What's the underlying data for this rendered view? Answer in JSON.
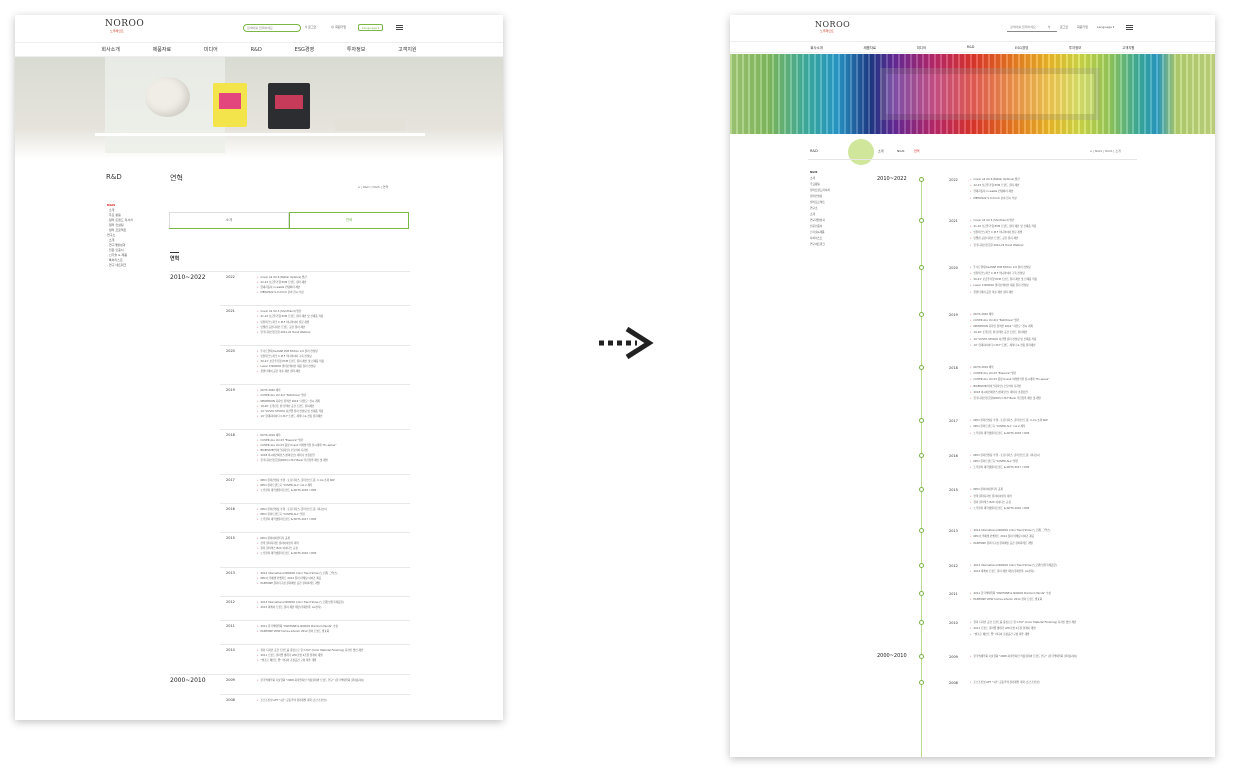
{
  "brand": {
    "logo": "NOROO",
    "logo_sub": "노루페인트"
  },
  "header": {
    "search_placeholder": "검색어를 입력하세요.",
    "login": "로그인",
    "signup": "회원가입",
    "language": "Language ▾"
  },
  "nav": [
    "회사소개",
    "제품자료",
    "미디어",
    "R&D",
    "ESG경영",
    "투자정보",
    "고객지원"
  ],
  "left": {
    "side_title": "R&D",
    "page_title": "연혁",
    "breadcrumb": "⌂ | R&D | NGIS | 연혁",
    "subnav": [
      {
        "t": "NGIS",
        "act": true
      },
      {
        "t": "· 소개"
      },
      {
        "t": "· 주요 활동"
      },
      {
        "t": "  · 컬러 트렌드 리서치"
      },
      {
        "t": "  · 컬러 컨설팅"
      },
      {
        "t": "  · 컬러 프로젝트"
      },
      {
        "t": " "
      },
      {
        "t": "연구소"
      },
      {
        "t": "· 소개"
      },
      {
        "t": "· 연구개발성과"
      },
      {
        "t": "  · 전문 인증서"
      },
      {
        "t": "  · 신기술 & 제품"
      },
      {
        "t": "  · 특허리스트"
      },
      {
        "t": "· 연구 네트워크"
      }
    ],
    "tabs": [
      "소개",
      "연혁"
    ],
    "section": "연혁"
  },
  "right": {
    "crumb_left": "R&D",
    "tab1": "소개",
    "tab2": "NGIS",
    "tab3": "연혁",
    "crumb_right": "⌂ | NGIS | NGIS | 소개",
    "sidenav": [
      "NGIS",
      "소개",
      "주요활동",
      "컬러트렌드리서치",
      "컬러컨설팅",
      "컬러프로젝트",
      "연구소",
      "소개",
      "연구개발성과",
      "전문인증서",
      "신기술&제품",
      "특허리스트",
      "연구네트워크"
    ]
  },
  "timeline": [
    {
      "era": "2010~2022",
      "year": "2022",
      "items": [
        "Cover All Vol.6 (Better Options) 발간",
        "22-23 보급주거형 PCM 트렌드 컬러 제안",
        "현대자동차 in-waste 컨템퍼러 제안",
        "MEW2022 S.U.D.O.K 분야 전시 수상"
      ]
    },
    {
      "year": "2021",
      "items": [
        "Cover All Vol.5 (Shorthand) 발간",
        "21-22 보급주거형 PCM 트렌드 컬러 제안 및 신제품 적용",
        "인천테크노파크 C.M.F 미니마이어 전문 개발",
        "인텔컴 공간디자인 트렌드 공간 컬러 제안",
        "한국디자인진흥원 2021-22 Trend Webinar"
      ]
    },
    {
      "year": "2020",
      "items": [
        "뚜나트연재 KLASSE POP Edition 2.0 컬러 컨설팅",
        "인천테크노파크 C.M.F 미니마이어 구축 컨설팅",
        "20-21' 보급주거형 PCM 트렌드 컬러 제안 및 신제품 적용",
        "Lauer X NOROO 콜라보레이션 제품 컬러 컨설팅",
        "플랜티테어 공간 미술 제안 컬러 제안"
      ]
    },
    {
      "year": "2019",
      "items": [
        "NCTS 2020 제작",
        "COVER ALL Vol.4/4 \"Nutritious\" 발간",
        "NEWMOON 디자인 컬렉션 2019 \"자유도\" 전시 개최",
        "19-20' 토목만든 팬 컬렉션 공간 트렌드 컬러제안",
        "19' VIVVIO STUDIO 사진앱 컬러 컨설팅 및 신제품 적용",
        "19' 현대지아이티 C.M.F 트렌드 세미나 & 전통 컬러제안"
      ]
    },
    {
      "year": "2018",
      "items": [
        "NCTS 2019 제작",
        "COVER ALL Vol.03 \"Essence\" 발간",
        "COVER ALL Vol.03 증정 Unsuk 미래방식을 전시개최 \"En-sense\"",
        "BIKEMATE(바이크디자인) 오토바이 디자인",
        "2018 아시아컨퍼런스(컨퍼런스) 세미나 초청강연",
        "한국디자인진흥원(KIDP) C.M.F Bank 추진협력 제안 및 개발"
      ]
    },
    {
      "year": "2017",
      "items": [
        "NPCI 컬러컨설팅 수행 - 토요타자스, 휴마코인드림, C.I.G.소개 SKP",
        "NPCI 컬러트렌드북 \"COVER ALL\" vol.2 제작",
        "노루컬러 대학생컬러트렌드 & NCTS 2018 / DDP"
      ]
    },
    {
      "year": "2016",
      "items": [
        "NPCI 컬러컨설팅 수행 - 토요타자스, 휴마코인드림, 퀴니보이",
        "NPCI 컬러트렌드북 \"COVER ALL\" 발간",
        "노루컬러 대학생컬러트렌드 & NCTS 2017 / DDP"
      ]
    },
    {
      "year": "2015",
      "items": [
        "NPCI 컬러아이덴티티 공개",
        "전략 컬러디자인 컬러아이덴티 제작",
        "컬러 컬러렉스 B2C 아이디스 규정",
        "노루컬러 대학생컬러트렌드 & NCTS 2016 / DDP"
      ]
    },
    {
      "year": "2013",
      "items": [
        "2014 International NOROO Color Trend Show (노르웨, 그역스)",
        "NPCI노루에셋 컨셉키트 2014 컬러 마케팅 아이즈 제공",
        "PANTONE 컬러리구성 컬러페인 공간 컬러파레트 개발"
      ]
    },
    {
      "year": "2012",
      "items": [
        "2013 International NOROO Color Trend Show (노르웨 인천국제공항)",
        "2013 파케이 트렌드 컬러 제안 제안(국제전략, LG전자)"
      ]
    },
    {
      "year": "2011",
      "items": [
        "2011 한국색채학회 \"PANTONE & NOROO Premium Paints\" 수상",
        "PANTONE VIEW home+interior 2012 컬러 트렌드 발표회"
      ]
    },
    {
      "year": "2010",
      "items": [
        "컬러 디자인 공간 트렌드를 중심으로 한 C.M.F (Color Material Finishing) 디자인 방안 제안",
        "2011 트렌드 컬러앱 생태가 LED조명 2조권 플레이 개발",
        "\"엔조로 페인트 앱\" 미디어 조성공간 구성 제주 개발"
      ]
    },
    {
      "era": "2000~2010",
      "year": "2009",
      "items": [
        "한국색채학회 기술협회 \"2008 지속연지인 적용컬러와 트렌드 연구\" (한국색채학회 컬러송지이)"
      ]
    },
    {
      "year": "2008",
      "items": [
        "조스조인설 APT \"1년\" 공동주택 컬러개발 계획 (조스조인설)"
      ]
    }
  ],
  "colors": {
    "accent": "#7ab648",
    "highlight": "#d22"
  }
}
